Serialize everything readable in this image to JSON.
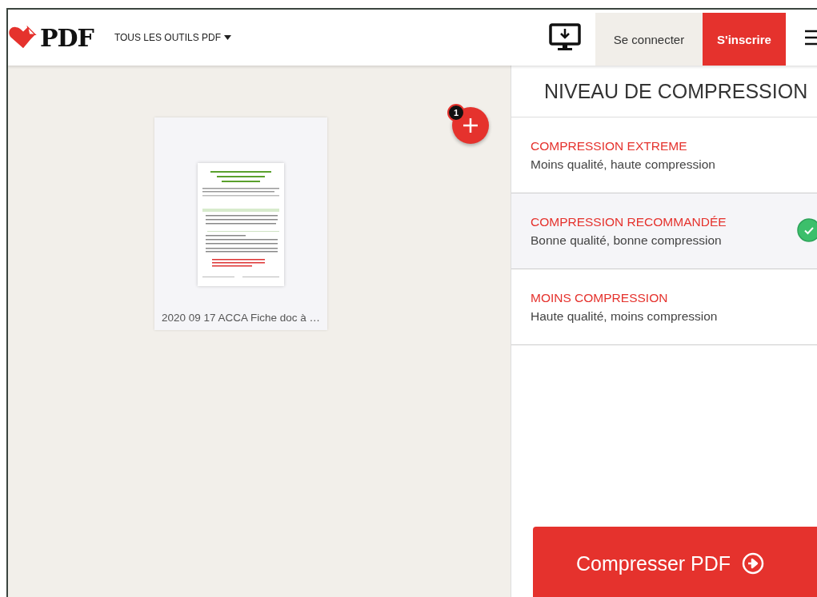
{
  "header": {
    "logo_text": "PDF",
    "tools_menu": "TOUS LES OUTILS PDF",
    "login": "Se connecter",
    "signup": "S'inscrire"
  },
  "files": [
    {
      "name": "2020 09 17 ACCA Fiche doc à …"
    }
  ],
  "add_button": {
    "badge": "1"
  },
  "panel": {
    "title": "NIVEAU DE COMPRESSION",
    "options": [
      {
        "title": "COMPRESSION EXTREME",
        "description": "Moins qualité, haute compression",
        "selected": false
      },
      {
        "title": "COMPRESSION RECOMMANDÉE",
        "description": "Bonne qualité, bonne compression",
        "selected": true
      },
      {
        "title": "MOINS COMPRESSION",
        "description": "Haute qualité, moins compression",
        "selected": false
      }
    ],
    "action": "Compresser PDF"
  }
}
